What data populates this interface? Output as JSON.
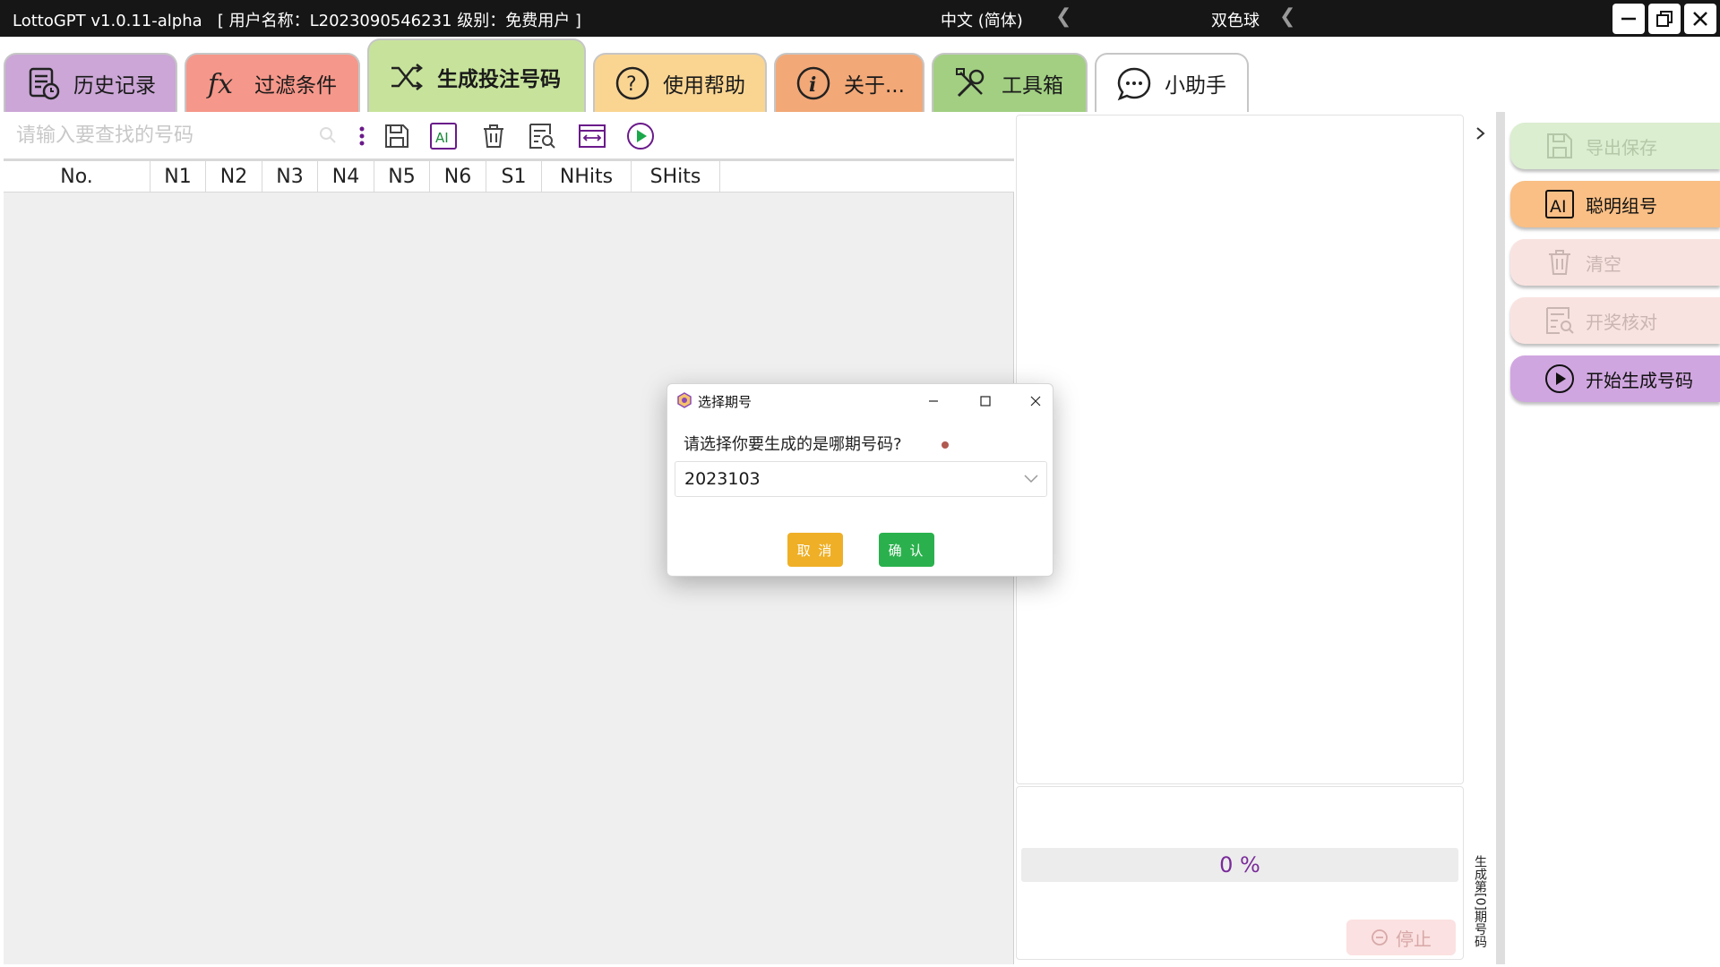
{
  "window": {
    "app_title": "LottoGPT v1.0.11-alpha",
    "user_info": "[ 用户名称：L2023090546231  级别：免费用户 ]",
    "language": "中文 (简体)",
    "game": "双色球"
  },
  "tabs": [
    {
      "label": "历史记录",
      "color": "#cba6d6",
      "icon": "history-icon"
    },
    {
      "label": "过滤条件",
      "color": "#f5978a",
      "icon": "function-icon"
    },
    {
      "label": "生成投注号码",
      "color": "#c7e39b",
      "icon": "shuffle-icon"
    },
    {
      "label": "使用帮助",
      "color": "#fad592",
      "icon": "help-icon"
    },
    {
      "label": "关于...",
      "color": "#f2a877",
      "icon": "info-icon"
    },
    {
      "label": "工具箱",
      "color": "#a2cf82",
      "icon": "tools-icon"
    },
    {
      "label": "小助手",
      "color": "#ffffff",
      "icon": "chat-icon"
    }
  ],
  "search": {
    "placeholder": "请输入要查找的号码"
  },
  "table": {
    "columns": [
      "No.",
      "N1",
      "N2",
      "N3",
      "N4",
      "N5",
      "N6",
      "S1",
      "NHits",
      "SHits"
    ],
    "rows": []
  },
  "progress": {
    "label": "0 %",
    "value": 0
  },
  "stop_label": "停止",
  "vertical_label": "生成第[0]期号码",
  "actions": [
    {
      "label": "导出保存",
      "enabled": false
    },
    {
      "label": "聪明组号",
      "enabled": true
    },
    {
      "label": "清空",
      "enabled": false
    },
    {
      "label": "开奖核对",
      "enabled": false
    },
    {
      "label": "开始生成号码",
      "enabled": true
    }
  ],
  "dialog": {
    "title": "选择期号",
    "question": "请选择你要生成的是哪期号码?",
    "selected_value": "2023103",
    "cancel_label": "取 消",
    "confirm_label": "确 认"
  },
  "colors": {
    "cancel_button": "#efb027",
    "confirm_button": "#2ab14d",
    "progress_text": "#7a2a9a",
    "play_icon": "#1aa84a"
  }
}
